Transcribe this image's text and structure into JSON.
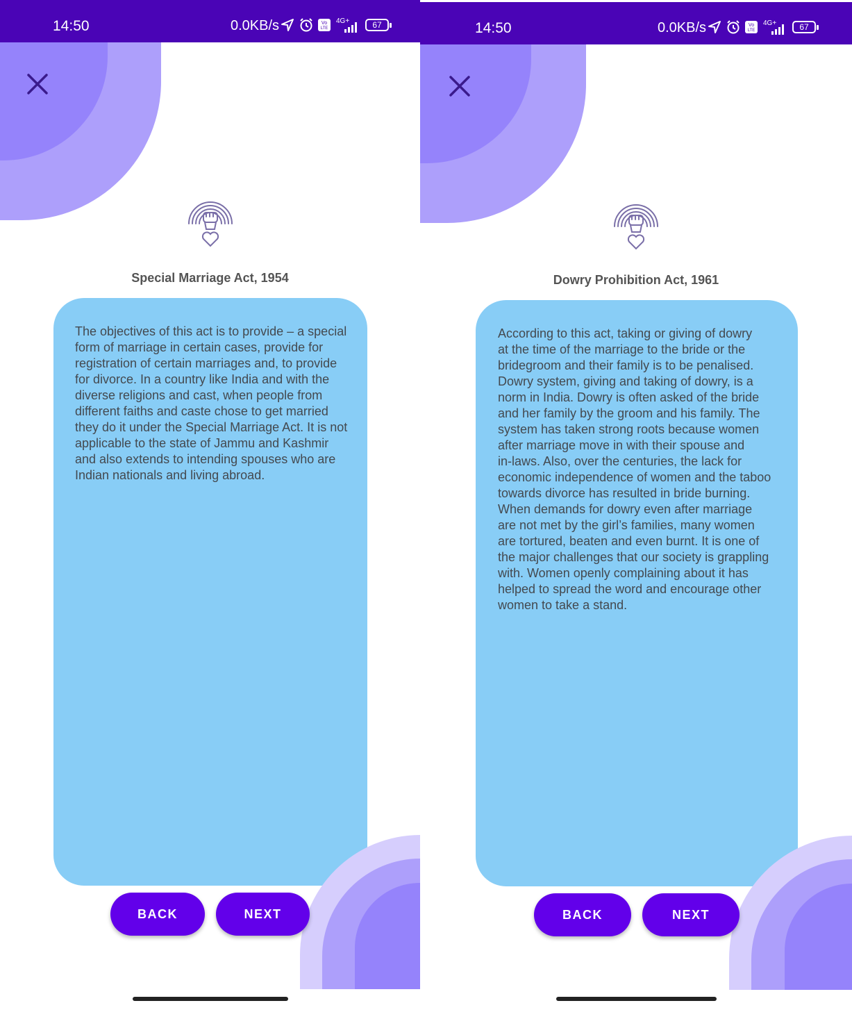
{
  "colors": {
    "status_bar": "#4a04b6",
    "blob_light": "#ad9ffb",
    "blob_dark": "#9583fb",
    "card": "#88cdf6",
    "button": "#6200ea",
    "close_icon": "#3a1a8c"
  },
  "screens": [
    {
      "status": {
        "time": "14:50",
        "net_rate": "0.0KB/s",
        "signal": "4G+",
        "volte": "Vo LTE",
        "battery": "67"
      },
      "title": "Special Marriage Act, 1954",
      "body": "The objectives of this act is to provide – a special\nform of marriage in certain cases, provide for\nregistration of certain marriages and, to provide\nfor divorce. In a country like India and with the\ndiverse religions and cast, when people from\ndifferent faiths and caste chose to get married\nthey do it under the Special Marriage Act. It is not\napplicable to the state of Jammu and Kashmir\nand also extends to intending spouses who are\nIndian nationals and living abroad.",
      "back_label": "BACK",
      "next_label": "NEXT",
      "icons": {
        "close": "close-icon",
        "emblem": "fist-rainbow-heart-icon"
      }
    },
    {
      "status": {
        "time": "14:50",
        "net_rate": "0.0KB/s",
        "signal": "4G+",
        "volte": "Vo LTE",
        "battery": "67"
      },
      "title": "Dowry Prohibition Act, 1961",
      "body": "According to this act, taking or giving of dowry\nat the time of the marriage to the bride or the\nbridegroom and their family is to be penalised.\nDowry system, giving and taking of dowry, is a\nnorm in India. Dowry is often asked of the bride\nand her family by the groom and his family. The\nsystem has taken strong roots because women\nafter marriage move in with their spouse and\nin-laws. Also, over the centuries, the lack for\neconomic independence of women and the taboo\ntowards divorce has resulted in bride burning.\nWhen demands for dowry even after marriage\nare not met by the girl’s families, many women\nare tortured, beaten and even burnt. It is one of\nthe major challenges that our society is grappling\nwith. Women openly complaining about it has\nhelped to spread the word and encourage other\nwomen to take a stand.",
      "back_label": "BACK",
      "next_label": "NEXT",
      "icons": {
        "close": "close-icon",
        "emblem": "fist-rainbow-heart-icon"
      }
    }
  ]
}
